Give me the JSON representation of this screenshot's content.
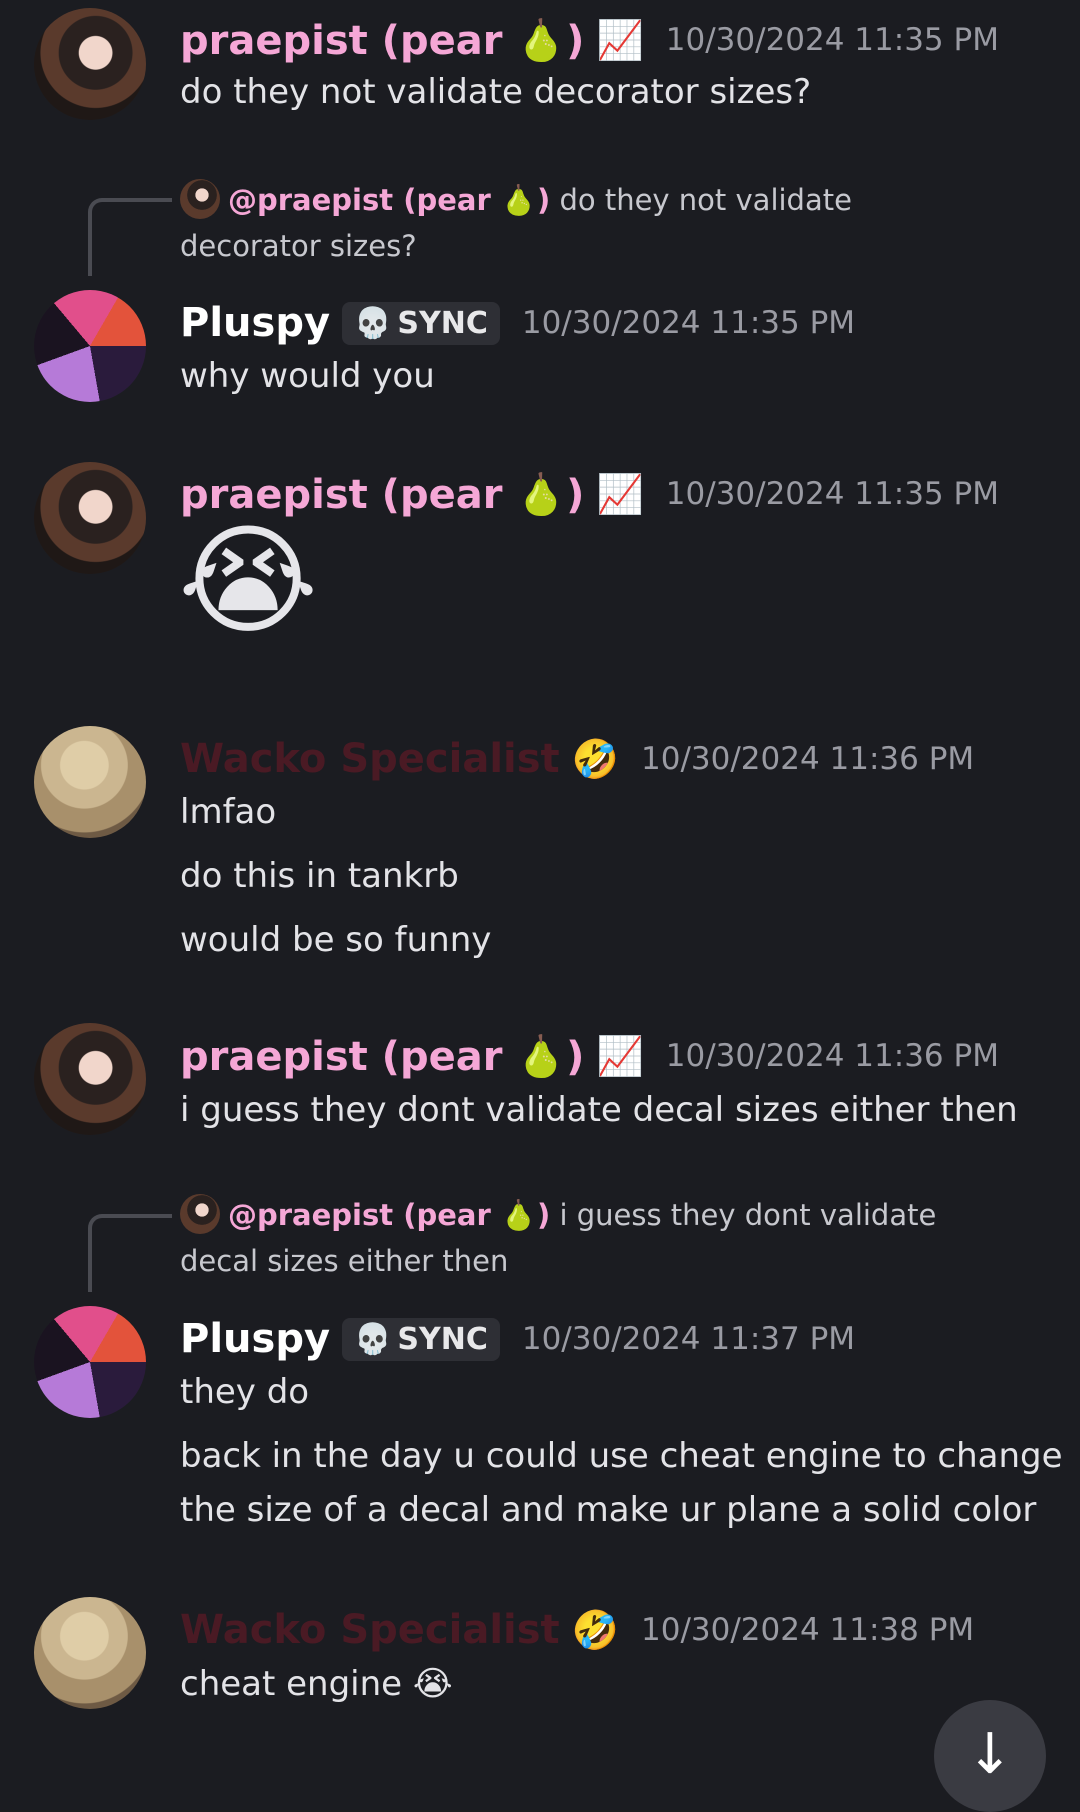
{
  "messages": [
    {
      "author": "praepist (pear 🍐)",
      "badge": "📈",
      "timestamp": "10/30/2024 11:35 PM",
      "lines": [
        "do they not validate decorator sizes?"
      ]
    },
    {
      "reply_to": {
        "author": "@praepist (pear 🍐)",
        "text": "do they not validate decorator sizes?"
      },
      "author": "Pluspy",
      "tag": "SYNC",
      "tag_icon": "💀",
      "timestamp": "10/30/2024 11:35 PM",
      "lines": [
        "why would you"
      ]
    },
    {
      "author": "praepist (pear 🍐)",
      "badge": "📈",
      "timestamp": "10/30/2024 11:35 PM",
      "big_emoji": "😭"
    },
    {
      "author": "Wacko Specialist",
      "badge": "🤣",
      "timestamp": "10/30/2024 11:36 PM",
      "lines": [
        "lmfao",
        "do this in tankrb",
        "would be so funny"
      ]
    },
    {
      "author": "praepist (pear 🍐)",
      "badge": "📈",
      "timestamp": "10/30/2024 11:36 PM",
      "lines": [
        "i guess they dont validate decal sizes either then"
      ]
    },
    {
      "reply_to": {
        "author": "@praepist (pear 🍐)",
        "text": "i guess they dont validate decal sizes either then"
      },
      "author": "Pluspy",
      "tag": "SYNC",
      "tag_icon": "💀",
      "timestamp": "10/30/2024 11:37 PM",
      "lines": [
        "they do",
        "back in the day u could use cheat engine to change",
        "the size of a decal and make ur plane a solid color"
      ]
    },
    {
      "author": "Wacko Specialist",
      "badge": "🤣",
      "timestamp": "10/30/2024 11:38 PM",
      "lines": [
        "cheat engine 😭"
      ]
    }
  ],
  "scroll_button_icon": "↓"
}
